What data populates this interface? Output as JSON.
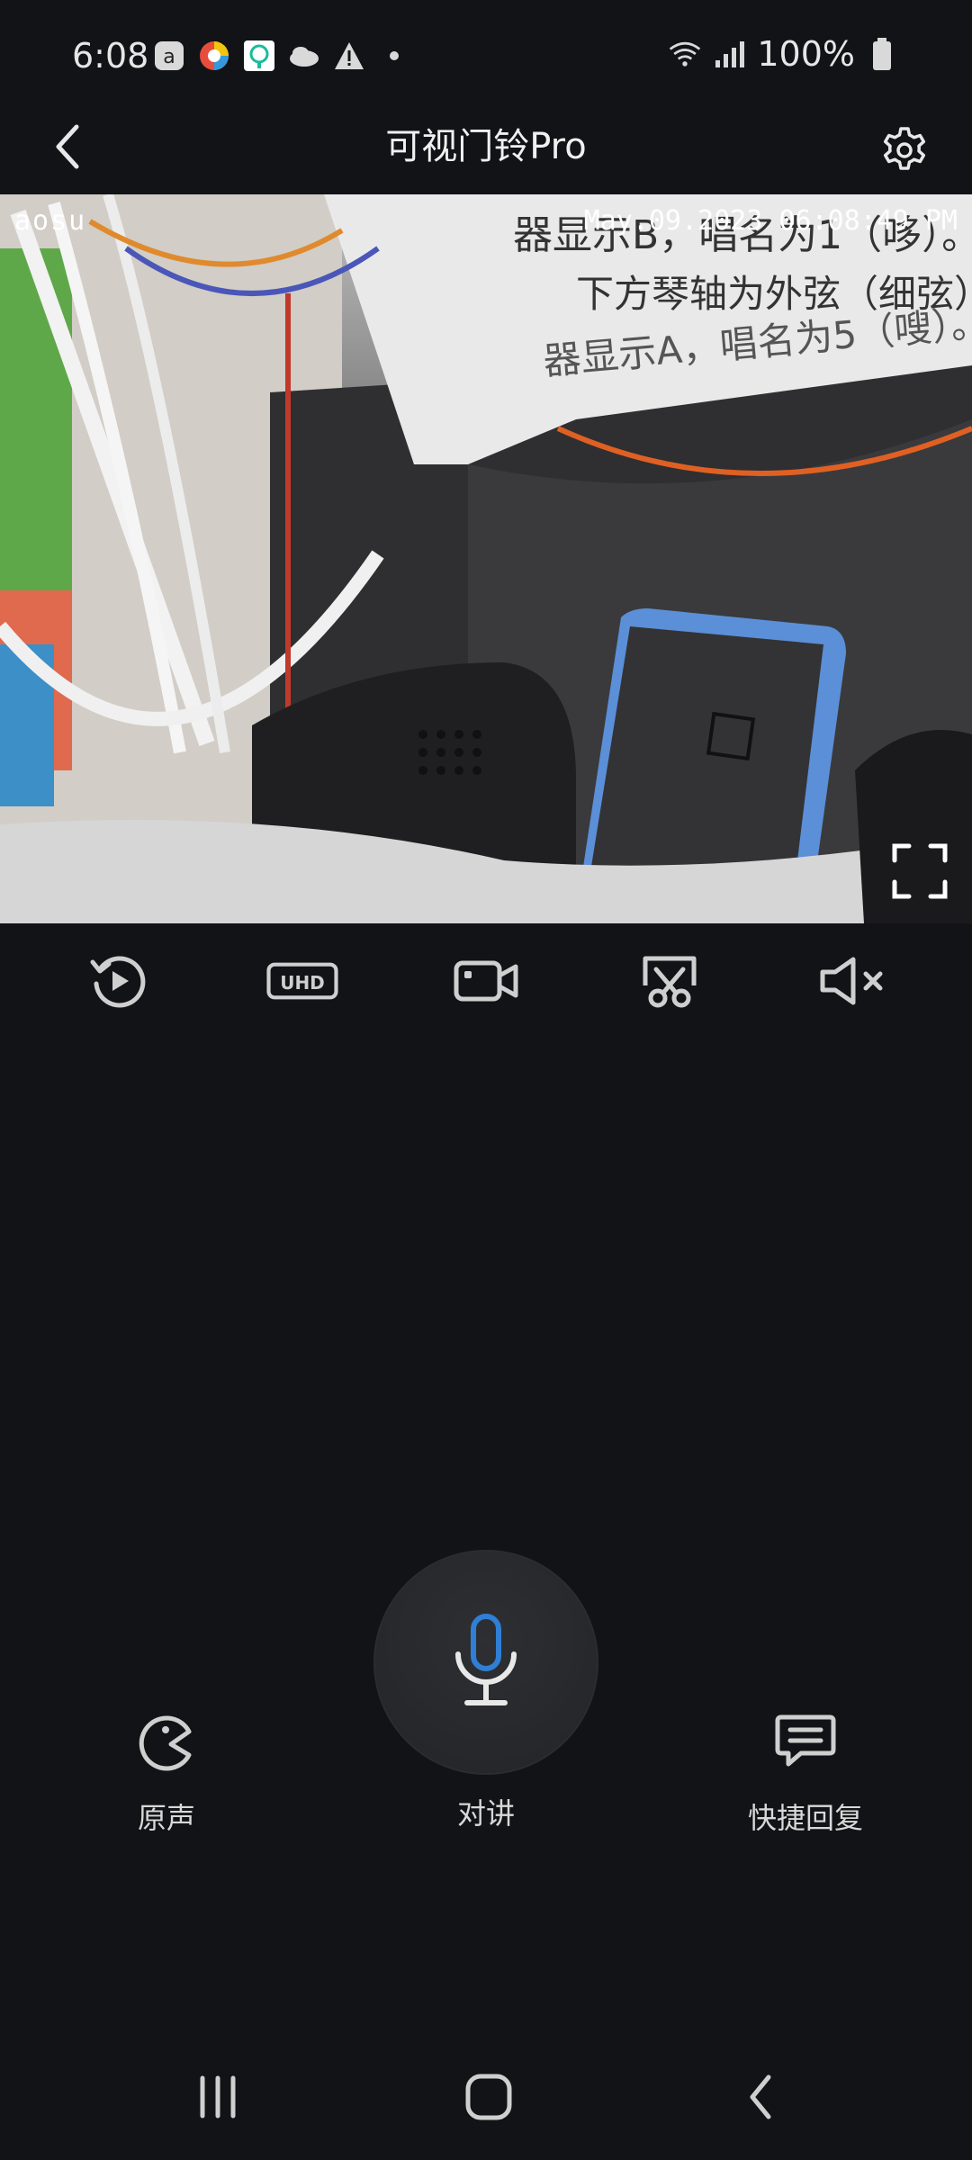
{
  "status_bar": {
    "time": "6:08",
    "battery": "100%",
    "notification_icons": [
      "app-a-icon",
      "colorful-circle-icon",
      "qr-lock-icon",
      "cloud-icon",
      "warning-icon",
      "dot-icon"
    ]
  },
  "header": {
    "title": "可视门铃Pro"
  },
  "video": {
    "brand_watermark": "aosu",
    "timestamp": "May.09.2023 06:08:49 PM",
    "note_line1": "器显示B，唱名为1（哆）。",
    "note_line2": "下方琴轴为外弦（细弦）校音",
    "note_line3": "器显示A，唱名为5（嗖）。"
  },
  "controls": [
    "playback-icon",
    "uhd-icon",
    "record-icon",
    "screenshot-icon",
    "mute-icon"
  ],
  "controls_uhd_label": "UHD",
  "actions": {
    "voice_label": "原声",
    "talk_label": "对讲",
    "quick_reply_label": "快捷回复"
  },
  "colors": {
    "background": "#121316",
    "mic_accent": "#2f7fd6"
  }
}
